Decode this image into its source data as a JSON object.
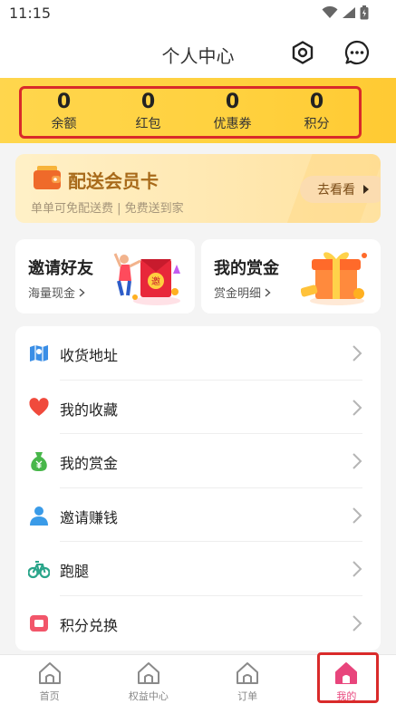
{
  "status_bar": {
    "time": "11:15"
  },
  "header": {
    "title": "个人中心"
  },
  "stats": [
    {
      "value": "0",
      "label": "余额"
    },
    {
      "value": "0",
      "label": "红包"
    },
    {
      "value": "0",
      "label": "优惠券"
    },
    {
      "value": "0",
      "label": "积分"
    }
  ],
  "member_card": {
    "title": "配送会员卡",
    "subtitle": "单单可免配送费 | 免费送到家",
    "button_label": "去看看"
  },
  "promos": [
    {
      "title": "邀请好友",
      "subtitle": "海量现金",
      "art_text": "邀"
    },
    {
      "title": "我的赏金",
      "subtitle": "赏金明细"
    }
  ],
  "menu": [
    {
      "label": "收货地址",
      "icon": "map-icon",
      "color": "#3a8ee6"
    },
    {
      "label": "我的收藏",
      "icon": "heart-icon",
      "color": "#f04a3c"
    },
    {
      "label": "我的赏金",
      "icon": "money-bag-icon",
      "color": "#48b74a"
    },
    {
      "label": "邀请赚钱",
      "icon": "user-icon",
      "color": "#3a9be8"
    },
    {
      "label": "跑腿",
      "icon": "bicycle-icon",
      "color": "#2aa58a"
    },
    {
      "label": "积分兑换",
      "icon": "points-icon",
      "color": "#f2566a"
    }
  ],
  "bottom_nav": [
    {
      "label": "首页",
      "icon": "home-icon",
      "active": false
    },
    {
      "label": "权益中心",
      "icon": "home-icon",
      "active": false
    },
    {
      "label": "订单",
      "icon": "home-icon",
      "active": false
    },
    {
      "label": "我的",
      "icon": "home-icon",
      "active": true
    }
  ],
  "colors": {
    "accent": "#e8457c",
    "header_yellow": "#ffd13e",
    "highlight": "#d92a2a"
  }
}
